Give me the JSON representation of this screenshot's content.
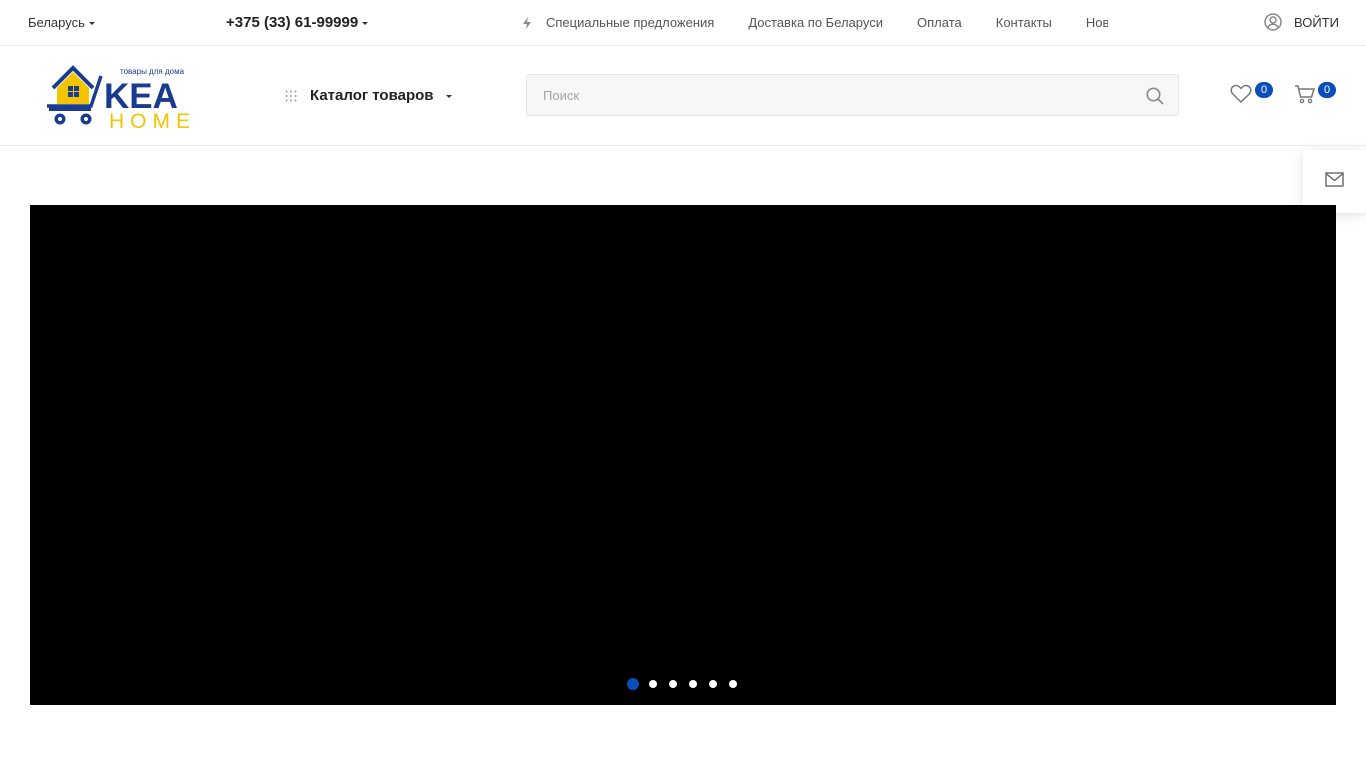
{
  "topbar": {
    "region": "Беларусь",
    "phone": "+375 (33) 61-99999",
    "nav": [
      {
        "label": "Специальные предложения"
      },
      {
        "label": "Доставка по Беларуси"
      },
      {
        "label": "Оплата"
      },
      {
        "label": "Контакты"
      },
      {
        "label": "Новости"
      }
    ],
    "login": "ВОЙТИ"
  },
  "header": {
    "logo": {
      "main": "KEA",
      "sub": "HOME",
      "tagline": "товары для дома"
    },
    "catalog_label": "Каталог товаров",
    "search": {
      "placeholder": "Поиск",
      "value": ""
    },
    "wishlist_count": "0",
    "cart_count": "0"
  },
  "slider": {
    "slide_count": 6,
    "active_index": 0
  },
  "colors": {
    "accent": "#0a4eb7",
    "logo_blue": "#1a3c8f",
    "logo_yellow": "#f5c400",
    "slide_bg": "#000000"
  }
}
